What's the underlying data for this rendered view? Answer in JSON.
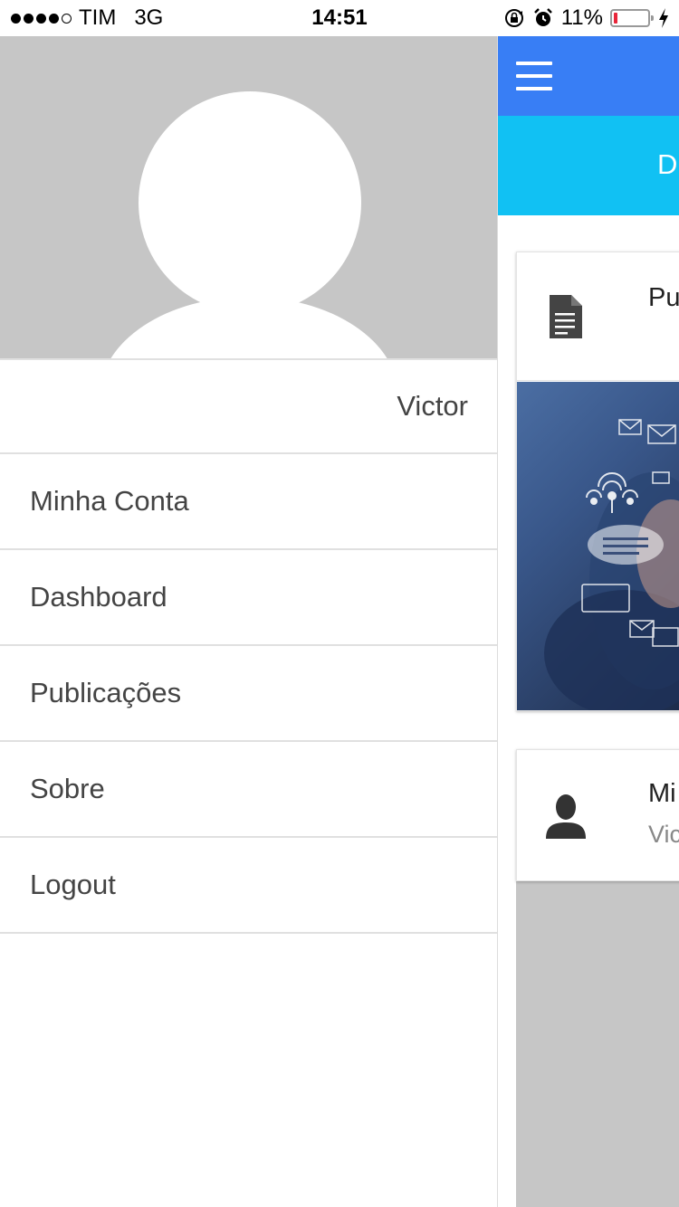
{
  "status_bar": {
    "carrier": "TIM",
    "network": "3G",
    "time": "14:51",
    "battery_percent": "11%",
    "battery_level": 0.11,
    "signal_bars_filled": 4,
    "signal_bars_total": 5
  },
  "drawer": {
    "username": "Victor",
    "items": [
      {
        "label": "Minha Conta"
      },
      {
        "label": "Dashboard"
      },
      {
        "label": "Publicações"
      },
      {
        "label": "Sobre"
      },
      {
        "label": "Logout"
      }
    ]
  },
  "main": {
    "subheader_title": "D",
    "card1_title": "Pu",
    "card2_title": "Mi",
    "card2_subtitle": "Vic"
  },
  "colors": {
    "toolbar": "#387ef5",
    "subheader": "#11c1f3",
    "profile_bg": "#c6c6c6",
    "battery_low": "#e8263a"
  },
  "icons": [
    "menu-icon",
    "document-icon",
    "person-icon",
    "lock-rotation-icon",
    "alarm-icon",
    "charging-icon"
  ]
}
